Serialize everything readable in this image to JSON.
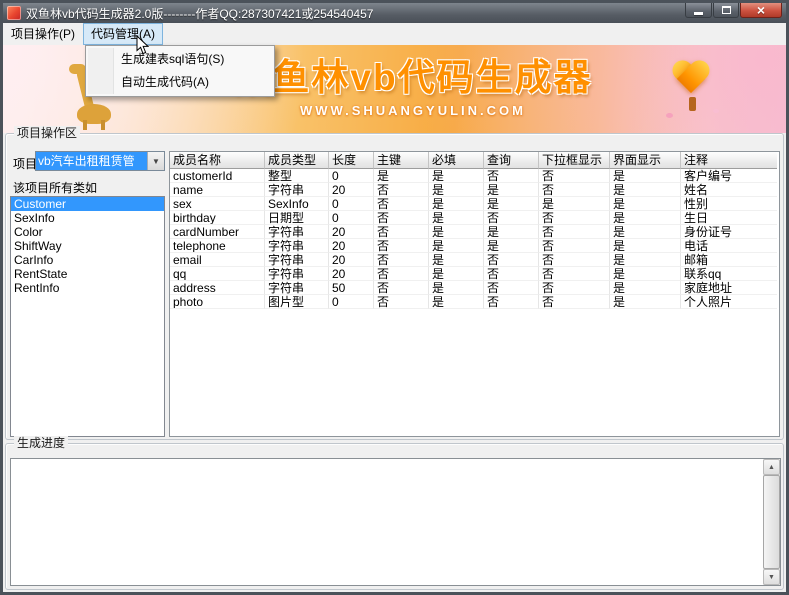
{
  "window": {
    "title": "双鱼林vb代码生成器2.0版--------作者QQ:287307421或254540457",
    "controls": {
      "close_glyph": "×"
    }
  },
  "menu": {
    "items": [
      {
        "label": "项目操作(P)"
      },
      {
        "label": "代码管理(A)"
      }
    ],
    "open_menu": "代码管理(A)",
    "dropdown_items": [
      {
        "label": "生成建表sql语句(S)"
      },
      {
        "label": "自动生成代码(A)"
      }
    ]
  },
  "banner": {
    "title": "双鱼林vb代码生成器",
    "subtitle": "WWW.SHUANGYULIN.COM"
  },
  "project_section": {
    "group_label": "项目操作区",
    "project_label": "项目",
    "project_combo_value": "vb汽车出租租赁管",
    "classes_label": "该项目所有类如",
    "selected_class": "Customer",
    "classes": [
      "Customer",
      "SexInfo",
      "Color",
      "ShiftWay",
      "CarInfo",
      "RentState",
      "RentInfo"
    ],
    "table": {
      "headers": [
        "成员名称",
        "成员类型",
        "长度",
        "主键",
        "必填",
        "查询",
        "下拉框显示",
        "界面显示",
        "注释"
      ],
      "rows": [
        [
          "customerId",
          "整型",
          "0",
          "是",
          "是",
          "否",
          "否",
          "是",
          "客户编号"
        ],
        [
          "name",
          "字符串",
          "20",
          "否",
          "是",
          "是",
          "否",
          "是",
          "姓名"
        ],
        [
          "sex",
          "SexInfo",
          "0",
          "否",
          "是",
          "是",
          "是",
          "是",
          "性别"
        ],
        [
          "birthday",
          "日期型",
          "0",
          "否",
          "是",
          "否",
          "否",
          "是",
          "生日"
        ],
        [
          "cardNumber",
          "字符串",
          "20",
          "否",
          "是",
          "是",
          "否",
          "是",
          "身份证号"
        ],
        [
          "telephone",
          "字符串",
          "20",
          "否",
          "是",
          "是",
          "否",
          "是",
          "电话"
        ],
        [
          "email",
          "字符串",
          "20",
          "否",
          "是",
          "否",
          "否",
          "是",
          "邮箱"
        ],
        [
          "qq",
          "字符串",
          "20",
          "否",
          "是",
          "否",
          "否",
          "是",
          "联系qq"
        ],
        [
          "address",
          "字符串",
          "50",
          "否",
          "是",
          "否",
          "否",
          "是",
          "家庭地址"
        ],
        [
          "photo",
          "图片型",
          "0",
          "否",
          "是",
          "否",
          "否",
          "是",
          "个人照片"
        ]
      ]
    }
  },
  "progress_section": {
    "group_label": "生成进度"
  },
  "colors": {
    "selection": "#3297FD",
    "banner_orange": "#FF9000",
    "titlebar": "#535961",
    "close_red": "#C8473B"
  },
  "icons": {
    "combo_arrow": "▼",
    "scroll_up": "▲",
    "scroll_down": "▼"
  }
}
